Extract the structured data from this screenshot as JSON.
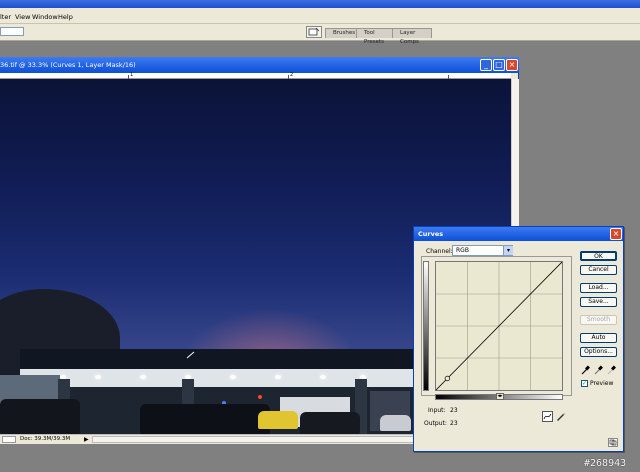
{
  "menubar": {
    "items": [
      "lter",
      "View",
      "Window",
      "Help"
    ]
  },
  "palette_well": {
    "tabs": [
      "Brushes",
      "Tool Presets",
      "Layer Comps"
    ]
  },
  "document": {
    "title": "36.tif @ 33.3% (Curves 1, Layer Mask/16)",
    "ruler_numbers": [
      "1",
      "2"
    ],
    "status_doc": "Doc: 39.3M/39.3M",
    "status_arrow": "▶"
  },
  "window_buttons": {
    "minimize": "_",
    "maximize": "□",
    "close": "×"
  },
  "curves_dialog": {
    "title": "Curves",
    "channel_label": "Channel:",
    "channel_value": "RGB",
    "input_label": "Input:",
    "input_value": "23",
    "output_label": "Output:",
    "output_value": "23",
    "control_point": {
      "input": 23,
      "output": 23
    },
    "buttons": {
      "ok": "OK",
      "cancel": "Cancel",
      "load": "Load...",
      "save": "Save...",
      "smooth": "Smooth",
      "auto": "Auto",
      "options": "Options..."
    },
    "preview_label": "Preview",
    "preview_checked": true,
    "close_glyph": "×"
  },
  "watermark": "#268943",
  "colors": {
    "titlebar": "#0c4fd6",
    "dialog_bg": "#ece9d8",
    "workspace": "#808080"
  }
}
